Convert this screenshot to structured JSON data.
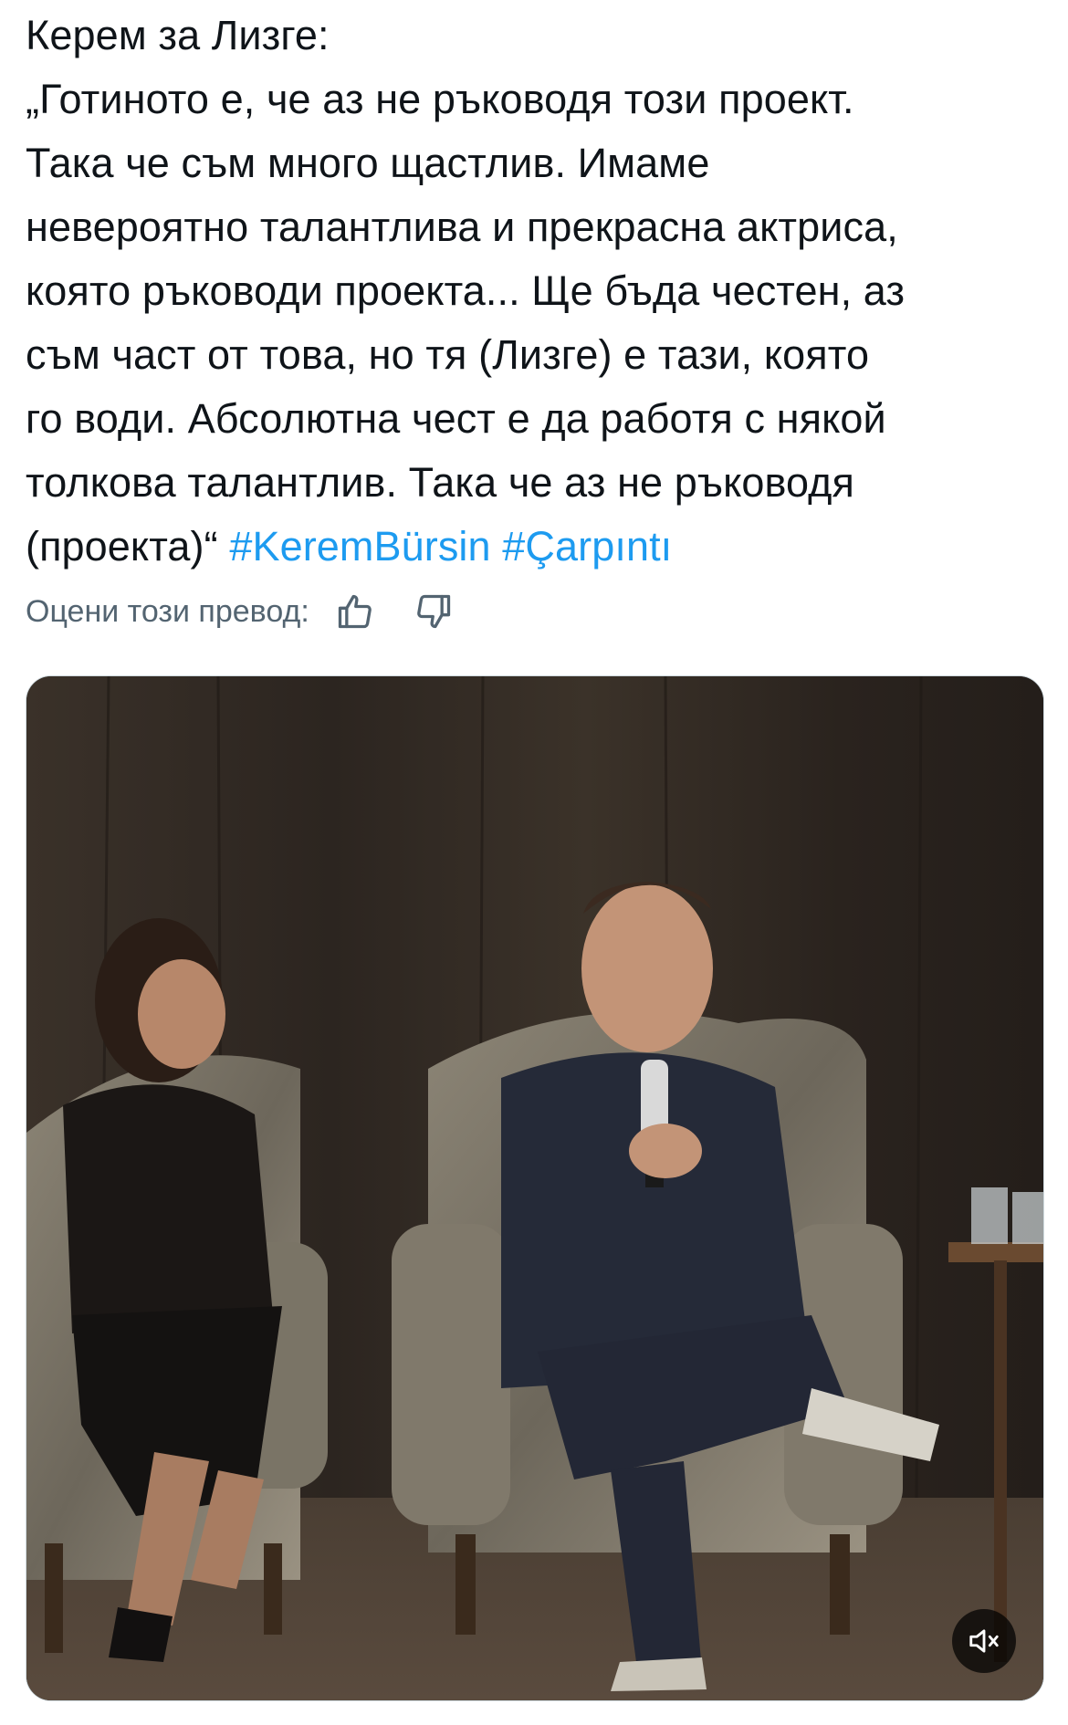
{
  "tweet": {
    "lines": [
      "Керем за Лизге:",
      "„Готиното е, че аз не ръководя този проект.",
      "Така че съм много щастлив. Имаме",
      "невероятно талантлива и прекрасна актриса,",
      "която ръководи проекта... Ще бъда честен, аз",
      "съм част от това, но тя (Лизге) е тази, която",
      "го води. Абсолютна чест е да работя с някой",
      "толкова талантлив. Така че аз не ръководя"
    ],
    "last_line_text": "(проекта)“",
    "hashtags": [
      "#KeremBürsin",
      "#Çarpıntı"
    ],
    "hashtag_color": "#1d9bf0"
  },
  "translation_rating": {
    "label": "Оцени този превод:",
    "thumbs_up_icon": "thumbs-up-icon",
    "thumbs_down_icon": "thumbs-down-icon"
  },
  "media": {
    "type": "video",
    "mute_icon": "volume-muted-icon"
  }
}
